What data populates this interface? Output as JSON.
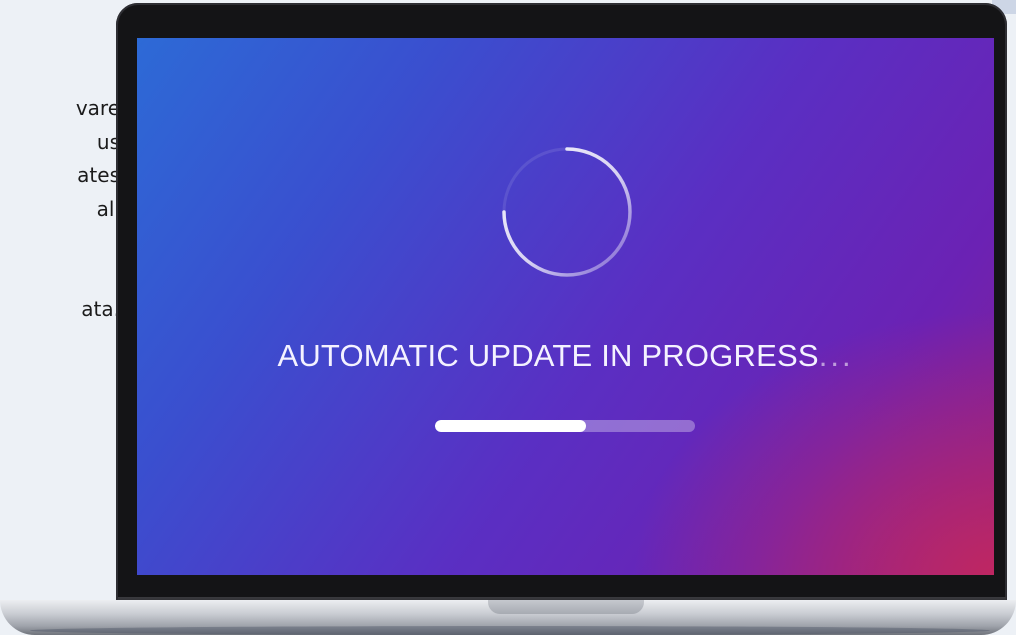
{
  "sidebar_text": {
    "line1": "vare",
    "line2": "us",
    "line3": "ates",
    "line4": "all",
    "line5": "ata."
  },
  "screen": {
    "status_label": "AUTOMATIC UPDATE IN PROGRESS",
    "status_ellipsis": "...",
    "progress_fraction": 0.58,
    "spinner_icon": "loading-spinner-icon"
  },
  "colors": {
    "screen_gradient_start": "#2d6ad6",
    "screen_gradient_mid": "#5a2fc3",
    "screen_gradient_end": "#c8285a",
    "progress_fill": "#ffffff",
    "progress_track": "#a98ad8"
  }
}
